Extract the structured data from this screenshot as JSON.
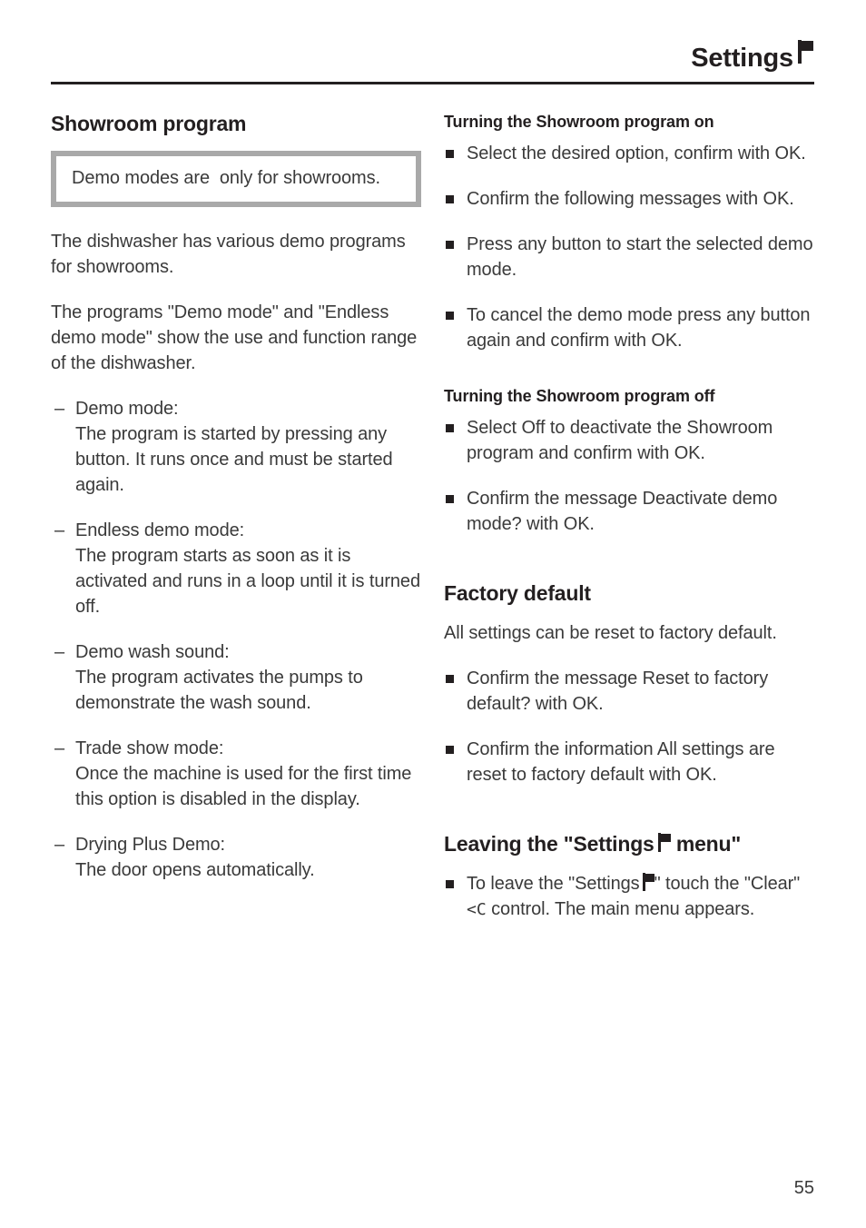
{
  "header": {
    "title": "Settings",
    "icon": "flag-icon"
  },
  "left_column": {
    "section_title": "Showroom program",
    "note": {
      "text": "Demo modes are  only for showrooms."
    },
    "paragraphs": [
      "The dishwasher has various demo programs for showrooms.",
      "The programs \"Demo mode\" and \"Endless demo mode\" show the use and function range of the dishwasher."
    ],
    "dash_marker": "–",
    "items": [
      {
        "term": "Demo mode:",
        "desc": "The program is started by pressing any button. It runs once and must be started again."
      },
      {
        "term": "Endless demo mode:",
        "desc": "The program starts as soon as it is activated and runs in a loop until it is turned off."
      },
      {
        "term": "Demo wash sound:",
        "desc": "The program activates the pumps to demonstrate the wash sound."
      },
      {
        "term": "Trade show mode:",
        "desc": "Once the machine is used for the first time this option is disabled in the display."
      },
      {
        "term": "Drying Plus Demo:",
        "desc": "The door opens automatically."
      }
    ]
  },
  "right_column": {
    "turning_on": {
      "title": "Turning the Showroom program on",
      "bullets": [
        "Select the desired option, confirm with OK.",
        "Confirm the following messages with OK.",
        "Press any button to start the selected demo mode.",
        "To cancel the demo mode press any button again and confirm with OK."
      ]
    },
    "turning_off": {
      "title": "Turning the Showroom program off",
      "bullets": [
        "Select Off to deactivate the Showroom program and confirm with OK.",
        "Confirm the message Deactivate demo mode? with OK."
      ]
    },
    "factory_default": {
      "title": "Factory default",
      "paragraph": "All settings can be reset to factory default.",
      "bullets": [
        "Confirm the message Reset to factory default? with OK.",
        "Confirm the information All settings are reset to factory default with OK."
      ]
    },
    "leaving_menu": {
      "title_before_icon": "Leaving the \"Settings",
      "title_after_icon": "menu\"",
      "bullet_part1": "To leave the \"Settings",
      "bullet_part2": "\" touch the \"Clear\"",
      "clear_control": "<C",
      "bullet_part3": "control. The main menu appears."
    }
  },
  "footer": {
    "page_number": "55"
  }
}
